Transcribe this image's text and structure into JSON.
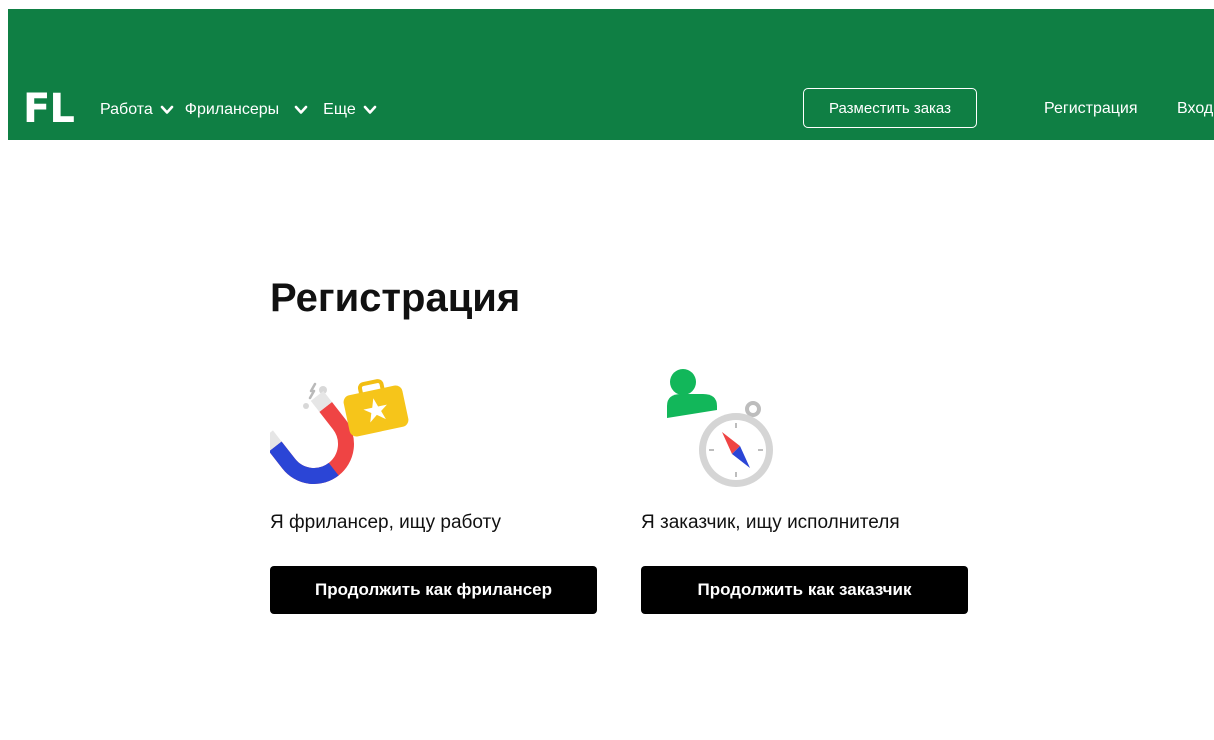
{
  "header": {
    "logo": "FL",
    "nav": [
      {
        "label": "Работа"
      },
      {
        "label": "Фрилансеры"
      },
      {
        "label": "Еще"
      }
    ],
    "order_button": "Разместить заказ",
    "register_link": "Регистрация",
    "login_link": "Вход",
    "background_color": "#0f7f44"
  },
  "main": {
    "title": "Регистрация",
    "cards": [
      {
        "icon": "magnet-briefcase-icon",
        "text": "Я фрилансер, ищу работу",
        "button": "Продолжить как фрилансер"
      },
      {
        "icon": "person-compass-icon",
        "text": "Я заказчик, ищу исполнителя",
        "button": "Продолжить как заказчик"
      }
    ]
  }
}
